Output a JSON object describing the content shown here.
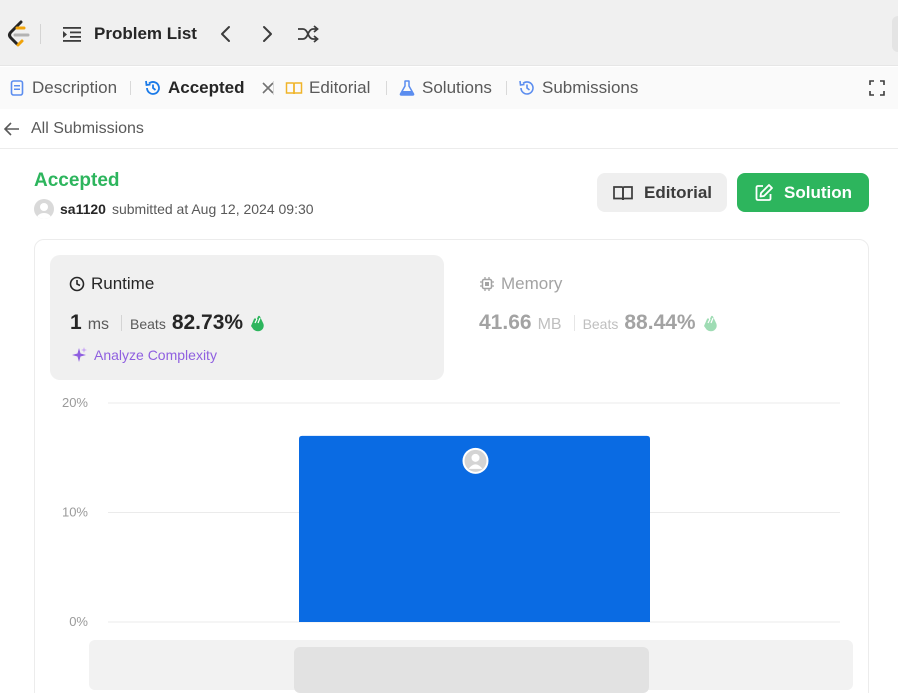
{
  "topbar": {
    "logo_icon": "leetcode-logo-icon",
    "problem_list_label": "Problem List",
    "prev_icon": "chevron-left-icon",
    "next_icon": "chevron-right-icon",
    "shuffle_icon": "shuffle-icon"
  },
  "tabs": [
    {
      "label": "Description",
      "icon": "document-icon",
      "icon_color": "#5b8def"
    },
    {
      "label": "Accepted",
      "icon": "history-icon",
      "icon_color": "#1a7ae8",
      "active": true,
      "closable": true
    },
    {
      "label": "Editorial",
      "icon": "book-icon",
      "icon_color": "#f0b429"
    },
    {
      "label": "Solutions",
      "icon": "flask-icon",
      "icon_color": "#5b8def"
    },
    {
      "label": "Submissions",
      "icon": "history-icon",
      "icon_color": "#5b8def"
    }
  ],
  "back": {
    "label": "All Submissions"
  },
  "submission": {
    "status": "Accepted",
    "status_color": "#2db55d",
    "user": "sa1120",
    "submitted_text": "submitted at Aug 12, 2024 09:30"
  },
  "buttons": {
    "editorial_label": "Editorial",
    "solution_label": "Solution"
  },
  "runtime": {
    "title": "Runtime",
    "value": "1",
    "unit": "ms",
    "beats_label": "Beats",
    "beats_value": "82.73%",
    "analyze_label": "Analyze Complexity"
  },
  "memory": {
    "title": "Memory",
    "value": "41.66",
    "unit": "MB",
    "beats_label": "Beats",
    "beats_value": "88.44%"
  },
  "chart_data": {
    "type": "bar",
    "y_ticks": [
      "20%",
      "10%",
      "0%"
    ],
    "ylim": [
      0,
      20
    ],
    "values": [
      17
    ],
    "bar_color": "#0a6be3",
    "grid": true
  }
}
